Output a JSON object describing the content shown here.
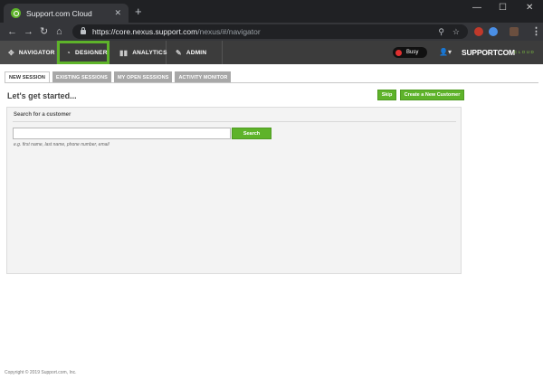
{
  "browser": {
    "tab_title": "Support.com Cloud",
    "tab_close": "✕",
    "new_tab": "+",
    "url_host": "https://core.nexus.support.com",
    "url_path": "/nexus/#/navigator",
    "win_min": "—",
    "win_max": "☐",
    "win_close": "✕",
    "back": "←",
    "forward": "→",
    "reload": "↻",
    "home": "⌂",
    "search_glyph": "⚲",
    "star_glyph": "☆",
    "menu": "⋮"
  },
  "appnav": {
    "items": [
      {
        "label": "NAVIGATOR",
        "icon": "✥"
      },
      {
        "label": "DESIGNER",
        "icon": "◔"
      },
      {
        "label": "ANALYTICS",
        "icon": "▮▮"
      },
      {
        "label": "ADMIN",
        "icon": "✎"
      }
    ],
    "status": "Busy",
    "user_glyph": "👤▾",
    "brand": "SUPPORTCOM",
    "brand_sub": "CLOUD"
  },
  "subtabs": [
    "NEW SESSION",
    "EXISTING SESSIONS",
    "MY OPEN SESSIONS",
    "ACTIVITY MONITOR"
  ],
  "page": {
    "heading": "Let's get started...",
    "skip_label": "Skip",
    "create_label": "Create a New Customer"
  },
  "search": {
    "title": "Search for a customer",
    "value": "",
    "button_label": "Search",
    "hint": "e.g. first name, last name, phone number, email"
  },
  "footer": "Copyright © 2019 Support.com, Inc.",
  "colors": {
    "accent": "#5eb32a",
    "nav_bg": "#3c3c3c",
    "status_dot": "#e03030"
  }
}
